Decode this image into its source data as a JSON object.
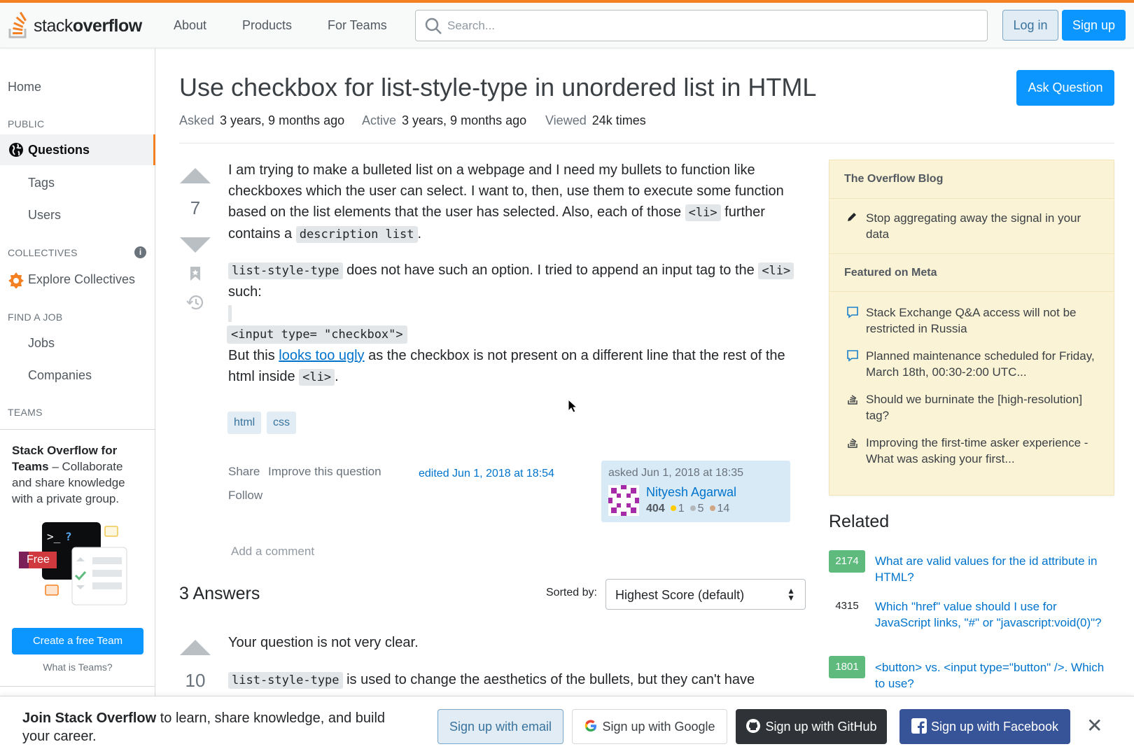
{
  "header": {
    "logo_text_light": "stack",
    "logo_text_bold": "overflow",
    "nav": [
      "About",
      "Products",
      "For Teams"
    ],
    "search_placeholder": "Search...",
    "login_label": "Log in",
    "signup_label": "Sign up",
    "accent_color": "#f48024",
    "primary_color": "#0a95ff"
  },
  "sidebar": {
    "home": "Home",
    "public_heading": "PUBLIC",
    "questions": "Questions",
    "tags": "Tags",
    "users": "Users",
    "collectives_heading": "COLLECTIVES",
    "explore_collectives": "Explore Collectives",
    "find_job_heading": "FIND A JOB",
    "jobs": "Jobs",
    "companies": "Companies",
    "teams_heading": "TEAMS",
    "teams_promo_bold": "Stack Overflow for Teams",
    "teams_promo_rest": " – Collaborate and share knowledge with a private group.",
    "free_badge": "Free",
    "create_team": "Create a free Team",
    "what_is_teams": "What is Teams?"
  },
  "question": {
    "title": "Use checkbox for list-style-type in unordered list in HTML",
    "ask_button": "Ask Question",
    "asked_label": "Asked",
    "asked_value": "3 years, 9 months ago",
    "active_label": "Active",
    "active_value": "3 years, 9 months ago",
    "viewed_label": "Viewed",
    "viewed_value": "24k times",
    "votes": "7",
    "p1_text": "I am trying to make a bulleted list on a webpage and I need my bullets to function like checkboxes which the user can select. I want to, then, use them to execute some function based on the list elements that the user has selected. Also, each of those ",
    "p1_code1": "<li>",
    "p1_mid": " further contains a ",
    "p1_code2": "description list",
    "p1_end": ".",
    "p2_code": "list-style-type",
    "p2_text": " does not have such an option. I tried to append an input tag to the ",
    "p2_code2": "<li>",
    "p2_end": " such:",
    "code_block": "<input type= \"checkbox\">",
    "p3_start": "But this ",
    "p3_link": "looks too ugly",
    "p3_mid": " as the checkbox is not present on a different line that the rest of the html inside ",
    "p3_code": "<li>",
    "p3_end": ".",
    "tags": [
      "html",
      "css"
    ],
    "share": "Share",
    "improve": "Improve this question",
    "follow": "Follow",
    "edited": "edited Jun 1, 2018 at 18:54",
    "asked_on": "asked Jun 1, 2018 at 18:35",
    "author": "Nityesh Agarwal",
    "reputation": "404",
    "gold": "1",
    "silver": "5",
    "bronze": "14",
    "add_comment": "Add a comment"
  },
  "answers": {
    "heading": "3 Answers",
    "sorted_by": "Sorted by:",
    "sort_value": "Highest Score (default)",
    "first_votes": "10",
    "first_p1": "Your question is not very clear.",
    "first_code": "list-style-type",
    "first_p2": " is used to change the aesthetics of the bullets, but they can't have"
  },
  "blog": {
    "heading1": "The Overflow Blog",
    "item1": "Stop aggregating away the signal in your data",
    "heading2": "Featured on Meta",
    "meta_items": [
      "Stack Exchange Q&A access will not be restricted in Russia",
      "Planned maintenance scheduled for Friday, March 18th, 00:30-2:00 UTC...",
      "Should we burninate the [high-resolution] tag?",
      "Improving the first-time asker experience - What was asking your first..."
    ],
    "bg_color": "#fbf3d5"
  },
  "related": {
    "heading": "Related",
    "items": [
      {
        "score": "2174",
        "title": "What are valid values for the id attribute in HTML?"
      },
      {
        "score": "4315",
        "title": "Which \"href\" value should I use for JavaScript links, \"#\" or \"javascript:void(0)\"?"
      },
      {
        "score": "1801",
        "title": "<button> vs. <input type=\"button\" />. Which to use?"
      }
    ]
  },
  "banner": {
    "bold": "Join Stack Overflow",
    "rest": " to learn, share knowledge, and build your career.",
    "email": "Sign up with email",
    "google": "Sign up with Google",
    "github": "Sign up with GitHub",
    "facebook": "Sign up with Facebook"
  }
}
